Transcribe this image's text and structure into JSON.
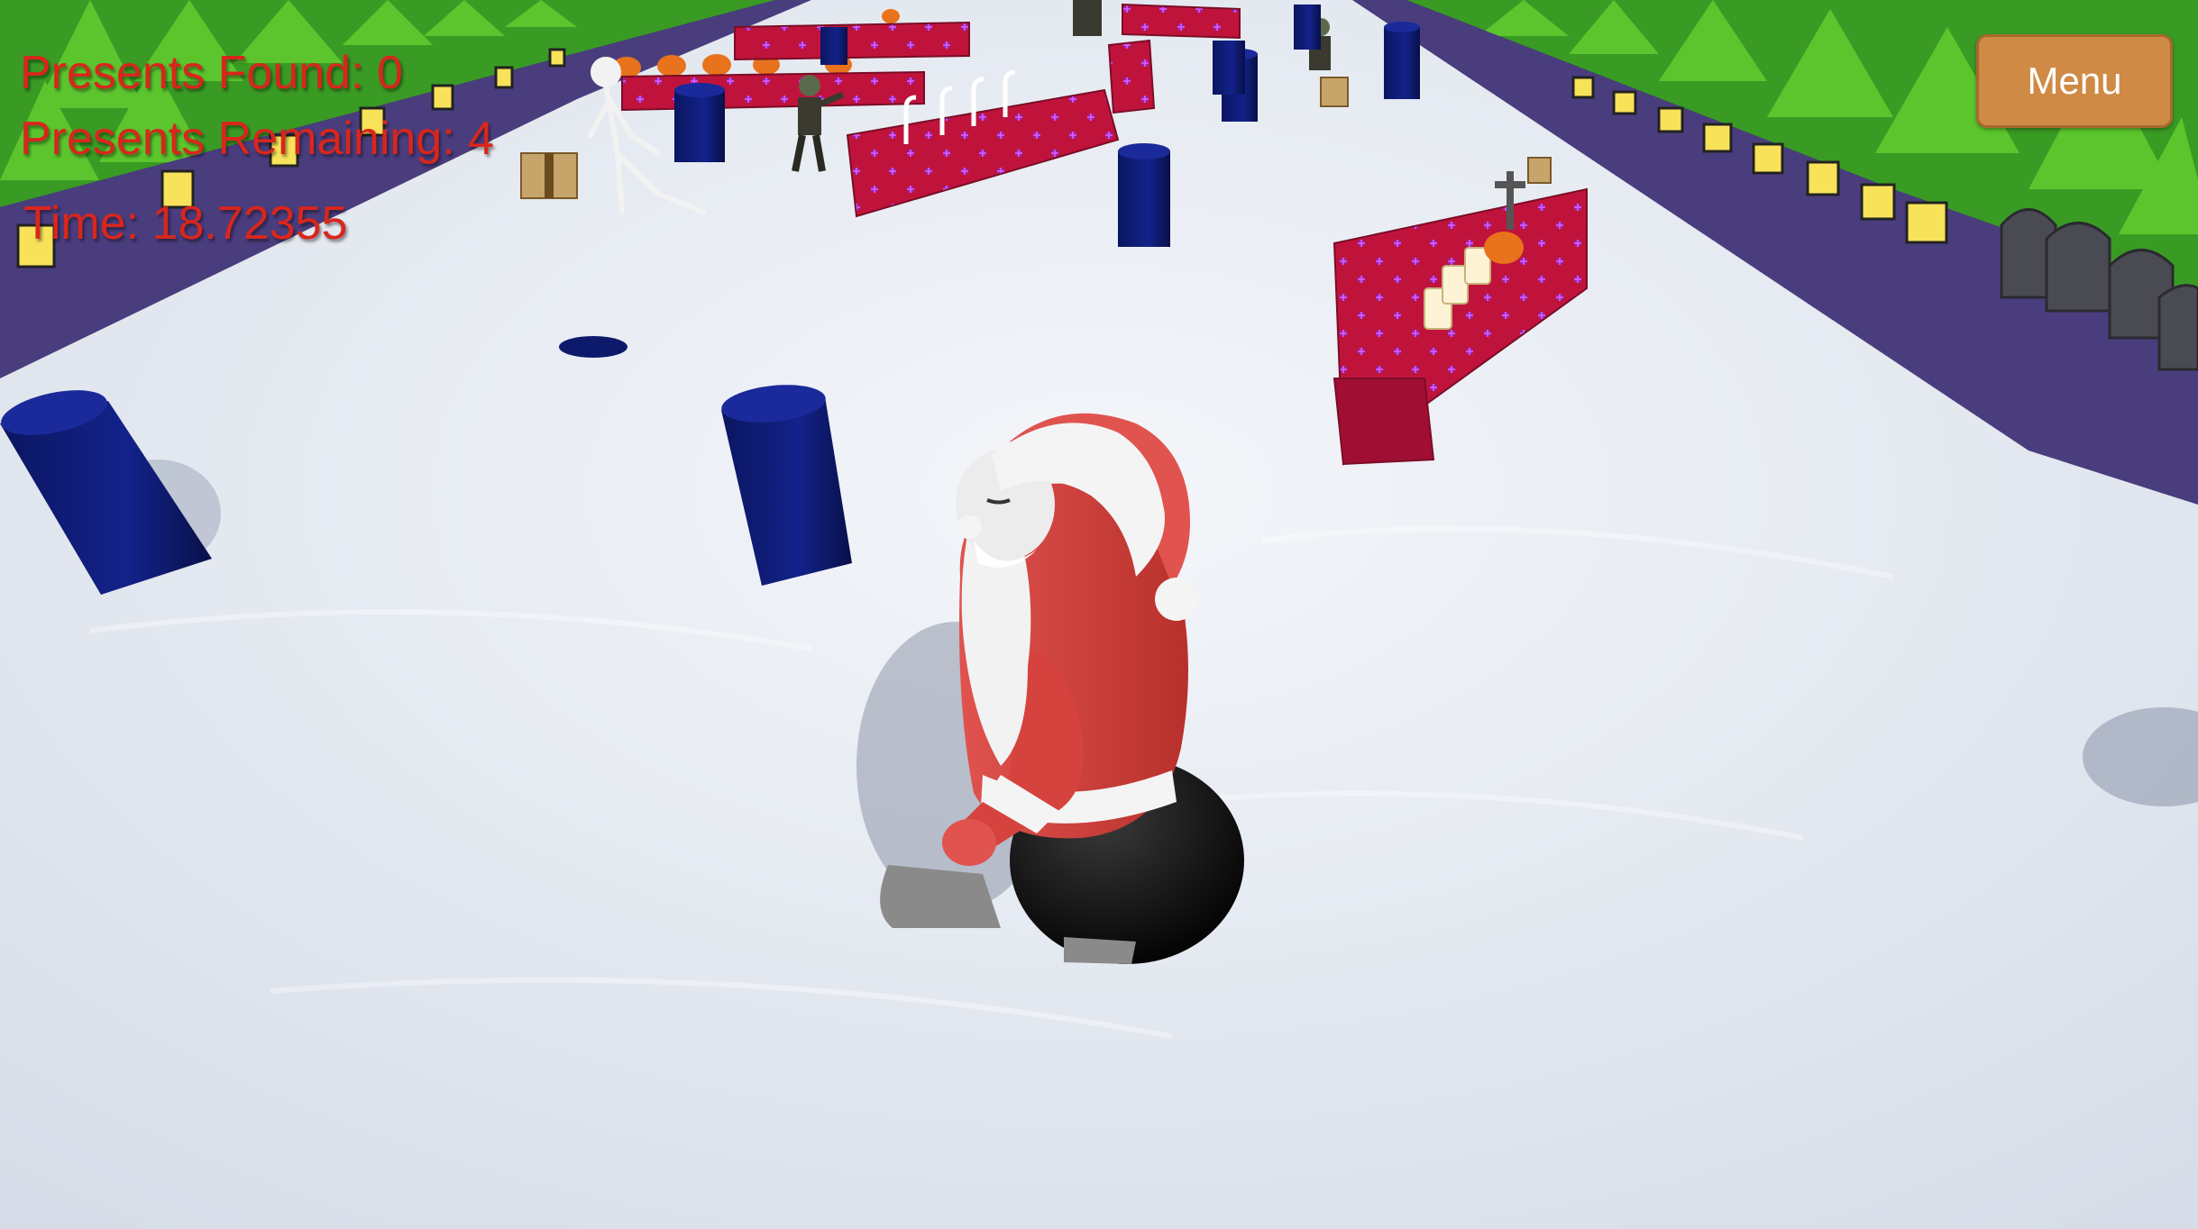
{
  "hud": {
    "presents_found": "Presents Found: 0",
    "presents_remaining": "Presents Remaining: 4",
    "time": "Time: 18.72355"
  },
  "menu": {
    "label": "Menu"
  },
  "colors": {
    "hud_text": "#d9261c",
    "menu_button": "#cf8a45",
    "snow": "#e9edf4",
    "path": "#4a3d7e",
    "pillar": "#0d1a6b",
    "gift_wall": "#c0133b",
    "tree": "#4fb82a"
  },
  "icons": [
    "santa-character",
    "christmas-tree-icon",
    "lantern-icon",
    "tombstone-icon",
    "pumpkin-icon",
    "candle-icon",
    "skeleton-icon",
    "zombie-icon",
    "present-box-icon"
  ]
}
